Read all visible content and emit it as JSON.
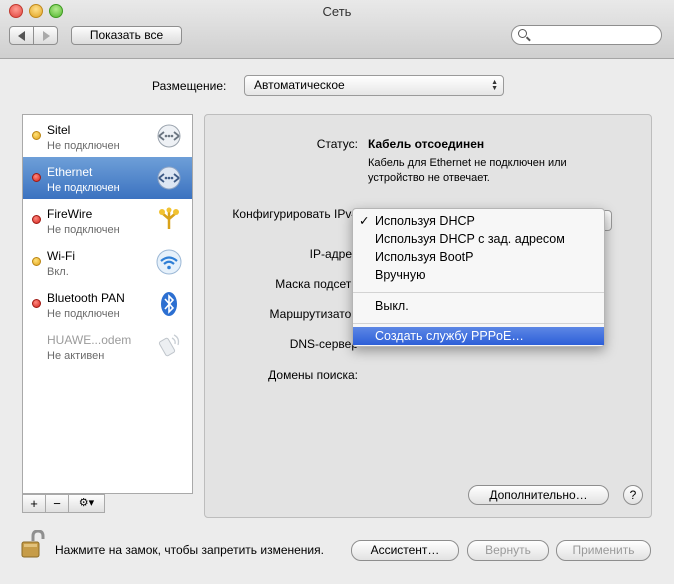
{
  "window": {
    "title": "Сеть"
  },
  "toolbar": {
    "show_all_label": "Показать все",
    "search_placeholder": ""
  },
  "location": {
    "label": "Размещение:",
    "value": "Автоматическое"
  },
  "services": [
    {
      "name": "Sitel",
      "status": "Не подключен",
      "dot": "yellow",
      "icon": "phone-modem-icon",
      "selected": false,
      "dim": false
    },
    {
      "name": "Ethernet",
      "status": "Не подключен",
      "dot": "red",
      "icon": "ethernet-icon",
      "selected": true,
      "dim": false
    },
    {
      "name": "FireWire",
      "status": "Не подключен",
      "dot": "red",
      "icon": "firewire-icon",
      "selected": false,
      "dim": false
    },
    {
      "name": "Wi-Fi",
      "status": "Вкл.",
      "dot": "yellow",
      "icon": "wifi-icon",
      "selected": false,
      "dim": false
    },
    {
      "name": "Bluetooth PAN",
      "status": "Не подключен",
      "dot": "red",
      "icon": "bluetooth-icon",
      "selected": false,
      "dim": false
    },
    {
      "name": "HUAWE...odem",
      "status": "Не активен",
      "dot": "none",
      "icon": "modem-icon",
      "selected": false,
      "dim": true
    }
  ],
  "sidebar_buttons": {
    "add": "+",
    "remove": "−",
    "action": "⚙▾"
  },
  "details": {
    "status_label": "Статус:",
    "status_value": "Кабель отсоединен",
    "status_description": "Кабель для Ethernet не подключен или устройство не отвечает.",
    "configure_label": "Конфигурировать IPv4",
    "ip_label": "IP-адрес",
    "subnet_label": "Маска подсети",
    "router_label": "Маршрутизатор",
    "dns_label": "DNS-сервер",
    "search_domains_label": "Домены поиска:"
  },
  "ipv4_menu": {
    "items": [
      "Используя DHCP",
      "Используя DHCP с зад. адресом",
      "Используя BootP",
      "Вручную"
    ],
    "checked_index": 0,
    "off_item": "Выкл.",
    "pppoe_item": "Создать службу PPPoE…"
  },
  "buttons": {
    "advanced": "Дополнительно…",
    "help": "?",
    "assistant": "Ассистент…",
    "revert": "Вернуть",
    "apply": "Применить"
  },
  "lock": {
    "text": "Нажмите на замок, чтобы запретить изменения."
  }
}
